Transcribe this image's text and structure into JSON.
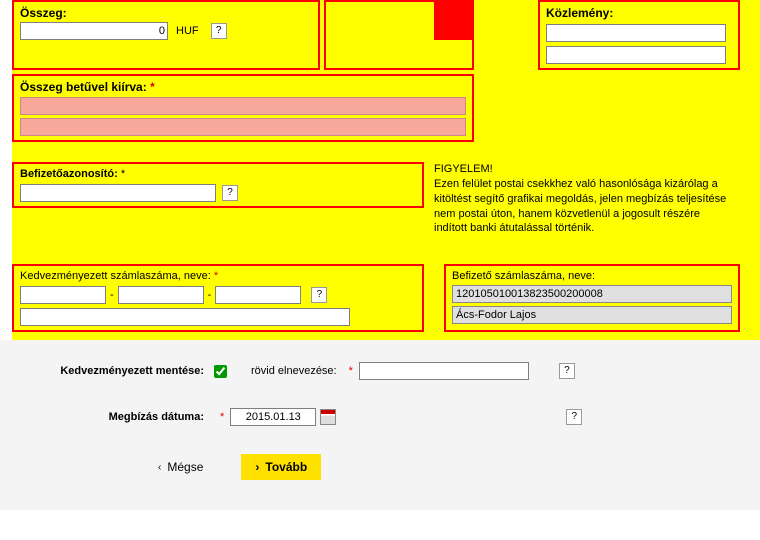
{
  "osszeg": {
    "label": "Összeg:",
    "value": "0",
    "currency": "HUF"
  },
  "betuvel": {
    "label": "Összeg betűvel kiírva:",
    "star": "*"
  },
  "kozlemeny": {
    "label": "Közlemény:"
  },
  "bazon": {
    "label": "Befizetőazonosító:",
    "star": "*"
  },
  "warning": {
    "title": "FIGYELEM!",
    "body": "Ezen felület postai csekkhez való hasonlósága kizárólag a kitöltést segítő grafikai megoldás, jelen megbízás teljesítése nem postai úton, hanem közvetlenül a jogosult részére indított banki átutalással történik."
  },
  "kedv": {
    "label": "Kedvezményezett számlaszáma, neve:",
    "star": "*",
    "dash": "-"
  },
  "bef": {
    "label": "Befizető számlaszáma, neve:",
    "account": "120105010013823500200008",
    "name": "Ács-Fodor Lajos"
  },
  "save_bene": {
    "label": "Kedvezményezett mentése:",
    "checked": true,
    "short_label": "rövid elnevezése:",
    "star": "*"
  },
  "date": {
    "label": "Megbízás dátuma:",
    "star": "*",
    "value": "2015.01.13"
  },
  "buttons": {
    "cancel": "Mégse",
    "next": "Tovább",
    "chev_left": "‹",
    "chev_right": "›"
  }
}
